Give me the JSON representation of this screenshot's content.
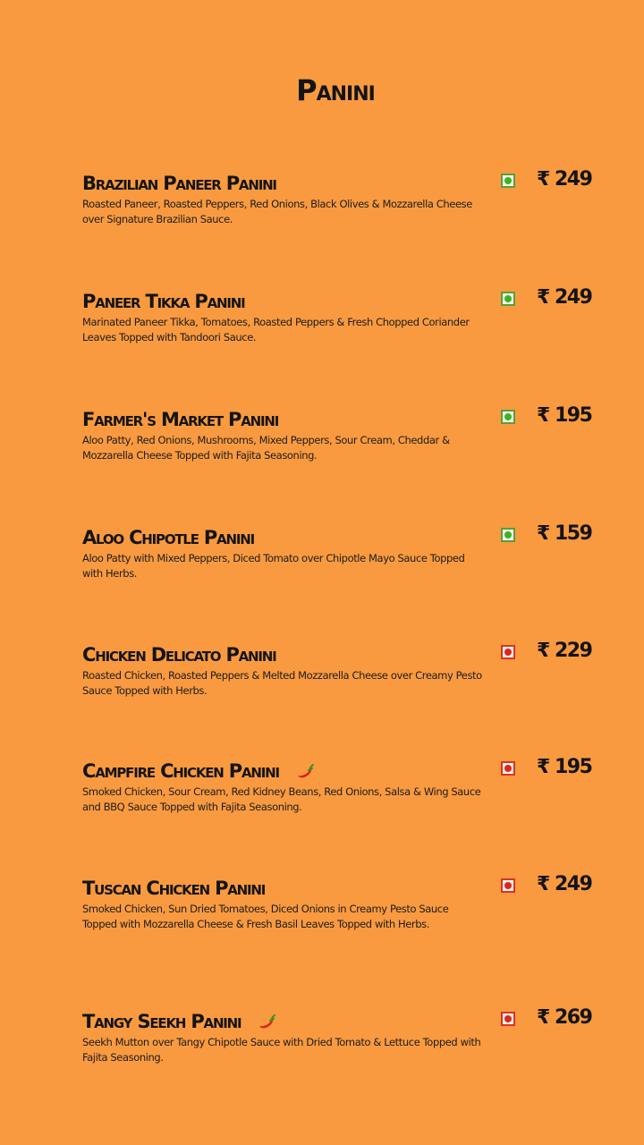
{
  "page": {
    "title": "Panini",
    "background_color": "#F99A40"
  },
  "items": [
    {
      "name": "Brazilian Paneer Panini",
      "description": "Roasted Paneer, Roasted Peppers, Red Onions, Black Olives & Mozzarella Cheese over Signature Brazilian Sauce.",
      "price": "₹ 249",
      "type": "veg",
      "spicy": false
    },
    {
      "name": "Paneer Tikka Panini",
      "description": "Marinated Paneer Tikka, Tomatoes, Roasted Peppers & Fresh Chopped Coriander Leaves Topped with Tandoori Sauce.",
      "price": "₹ 249",
      "type": "veg",
      "spicy": false
    },
    {
      "name": "Farmer's Market Panini",
      "description": "Aloo Patty, Red Onions, Mushrooms, Mixed Peppers, Sour Cream, Cheddar & Mozzarella Cheese Topped with Fajita Seasoning.",
      "price": "₹ 195",
      "type": "veg",
      "spicy": false
    },
    {
      "name": "Aloo Chipotle Panini",
      "description": "Aloo Patty with Mixed Peppers, Diced Tomato over Chipotle Mayo Sauce Topped with Herbs.",
      "price": "₹ 159",
      "type": "veg",
      "spicy": false
    },
    {
      "name": "Chicken Delicato Panini",
      "description": "Roasted Chicken, Roasted Peppers & Melted Mozzarella Cheese over Creamy Pesto Sauce Topped with Herbs.",
      "price": "₹ 229",
      "type": "non-veg",
      "spicy": false
    },
    {
      "name": "Campfire Chicken Panini",
      "description": "Smoked Chicken, Sour Cream, Red Kidney Beans, Red Onions, Salsa & Wing Sauce and BBQ Sauce Topped with Fajita Seasoning.",
      "price": "₹ 195",
      "type": "non-veg",
      "spicy": true
    },
    {
      "name": "Tuscan Chicken Panini",
      "description": "Smoked Chicken, Sun Dried Tomatoes, Diced Onions in Creamy Pesto Sauce Topped with Mozzarella Cheese & Fresh Basil Leaves Topped with Herbs.",
      "price": "₹ 249",
      "type": "non-veg",
      "spicy": false
    },
    {
      "name": "Tangy Seekh Panini",
      "description": "Seekh Mutton over Tangy Chipotle Sauce with Dried Tomato & Lettuce Topped with Fajita Seasoning.",
      "price": "₹ 269",
      "type": "non-veg",
      "spicy": true
    }
  ],
  "icons": {
    "veg": "veg-indicator-icon",
    "non_veg": "non-veg-indicator-icon",
    "spicy": "chili-pepper-icon"
  },
  "colors": {
    "veg_green": "#39b51f",
    "non_veg_red": "#e0241a"
  }
}
